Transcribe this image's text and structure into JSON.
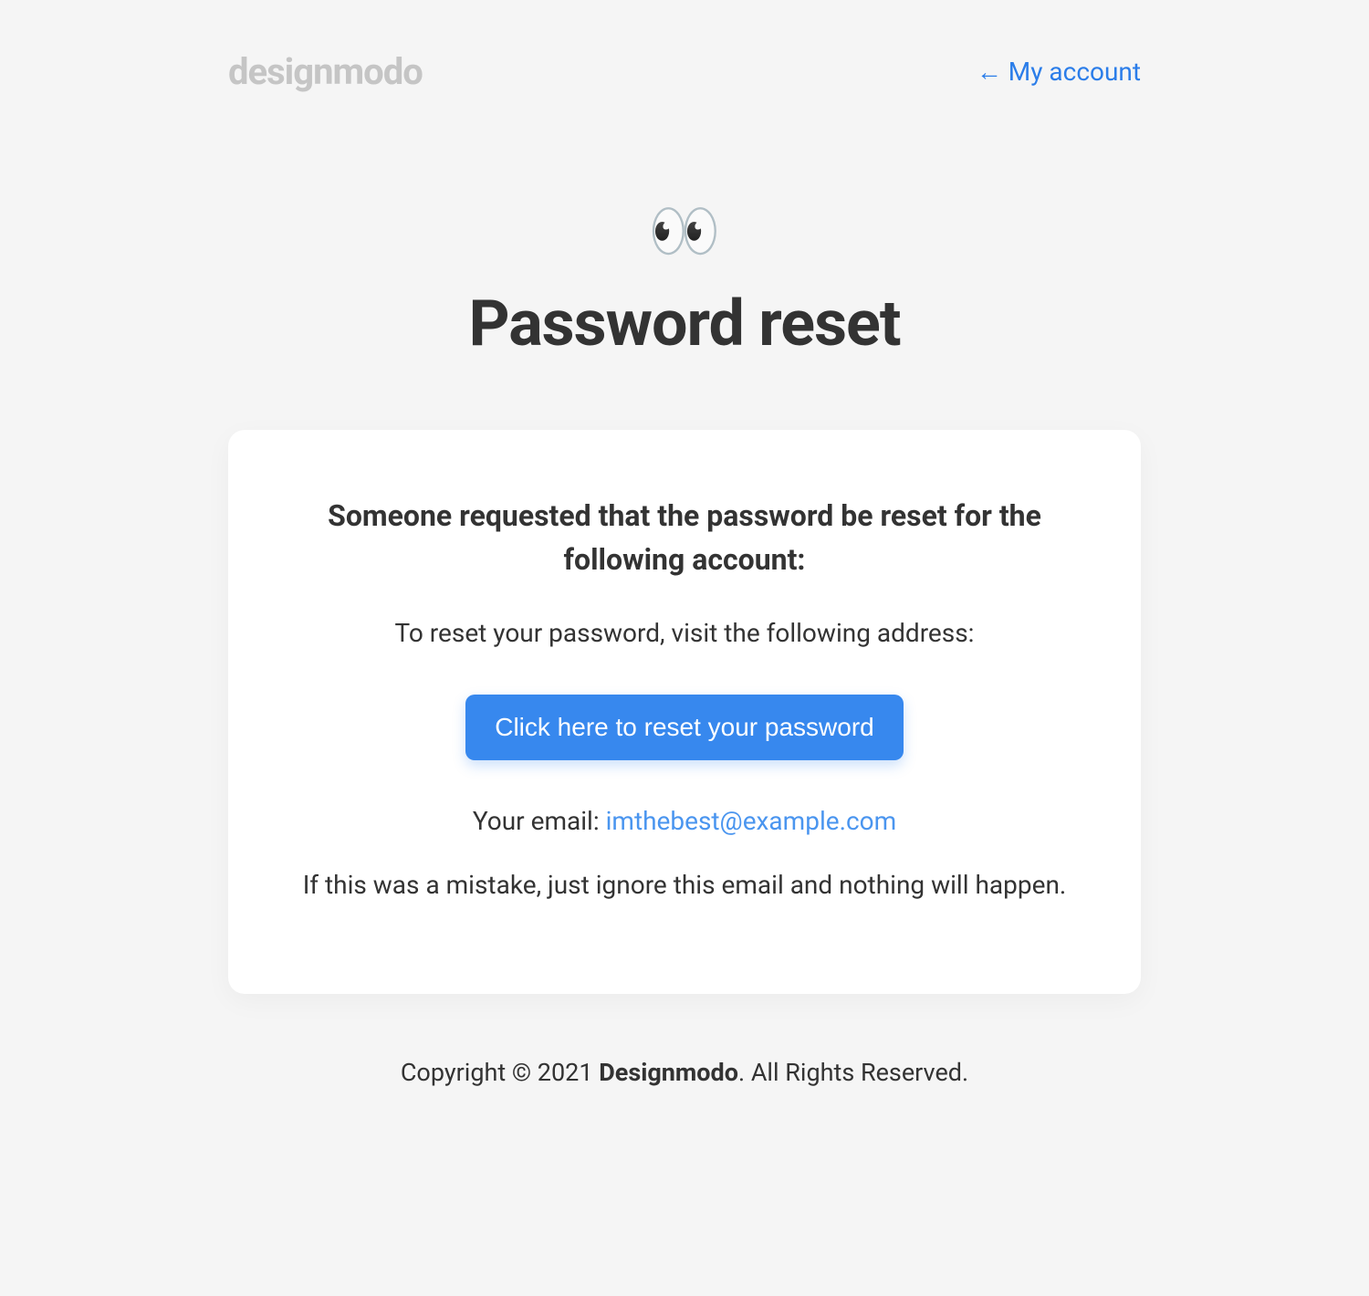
{
  "header": {
    "logo": "designmodo",
    "account_link": "← My account"
  },
  "hero": {
    "emoji": "👀",
    "title": "Password reset"
  },
  "card": {
    "heading": "Someone requested that the password be reset for the following account:",
    "instruction": "To reset your password, visit the following address:",
    "cta": "Click here to reset your password",
    "email_label": "Your email: ",
    "email_value": "imthebest@example.com",
    "mistake_note": "If this was a mistake, just ignore this email and nothing will happen."
  },
  "footer": {
    "copyright_prefix": "Copyright © 2021 ",
    "brand": "Designmodo",
    "copyright_suffix": ". All Rights Reserved."
  },
  "colors": {
    "background": "#f5f5f5",
    "link": "#2b7de9",
    "button": "#3788ee",
    "logo": "#c5c5c5",
    "text": "#333333"
  }
}
